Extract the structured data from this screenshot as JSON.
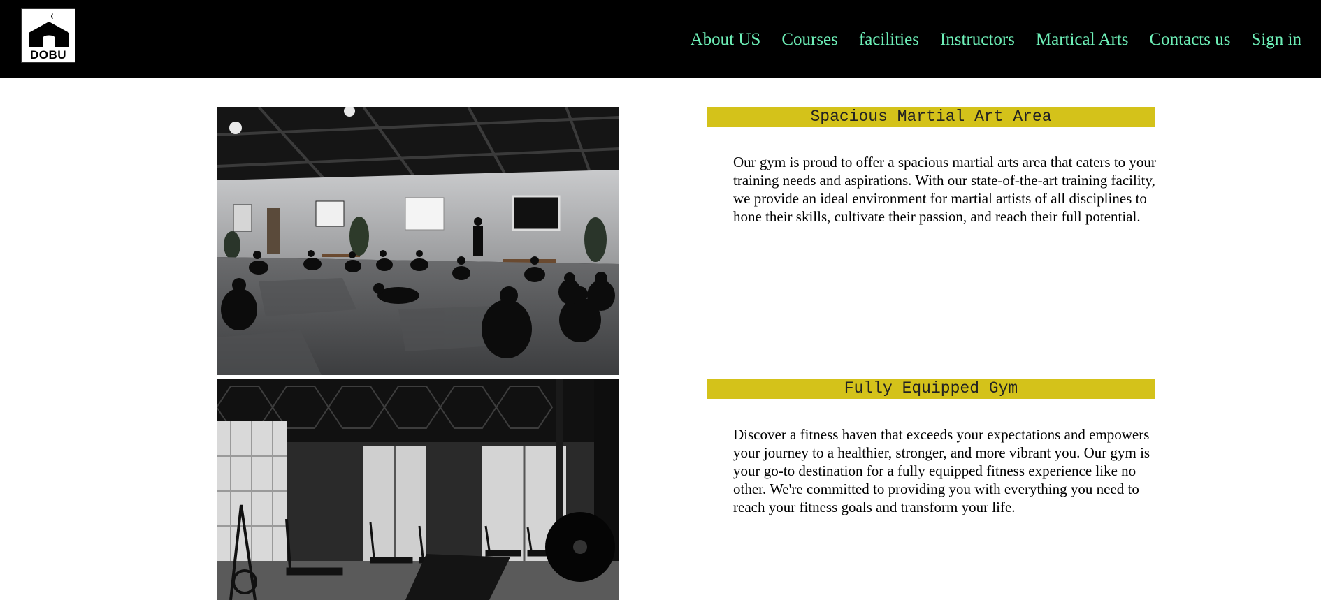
{
  "brand": {
    "logo_text": "DOBU"
  },
  "nav": {
    "items": [
      {
        "label": "About US"
      },
      {
        "label": "Courses"
      },
      {
        "label": "facilities"
      },
      {
        "label": "Instructors"
      },
      {
        "label": "Martical Arts"
      },
      {
        "label": "Contacts us"
      },
      {
        "label": "Sign in"
      }
    ]
  },
  "facilities": [
    {
      "title": "Spacious Martial Art Area",
      "description": "Our gym is proud to offer a spacious martial arts area that caters to your training needs and aspirations. With our state-of-the-art training facility, we provide an ideal environment for martial artists of all disciplines to hone their skills, cultivate their passion, and reach their full potential."
    },
    {
      "title": "Fully Equipped Gym",
      "description": "Discover a fitness haven that exceeds your expectations and empowers your journey to a healthier, stronger, and more vibrant you. Our gym is your go-to destination for a fully equipped fitness experience like no other. We're committed to providing you with everything you need to reach your fitness goals and transform your life."
    }
  ],
  "colors": {
    "nav_text": "#6ef0b8",
    "heading_bg": "#d4c21a",
    "header_bg": "#000000"
  }
}
